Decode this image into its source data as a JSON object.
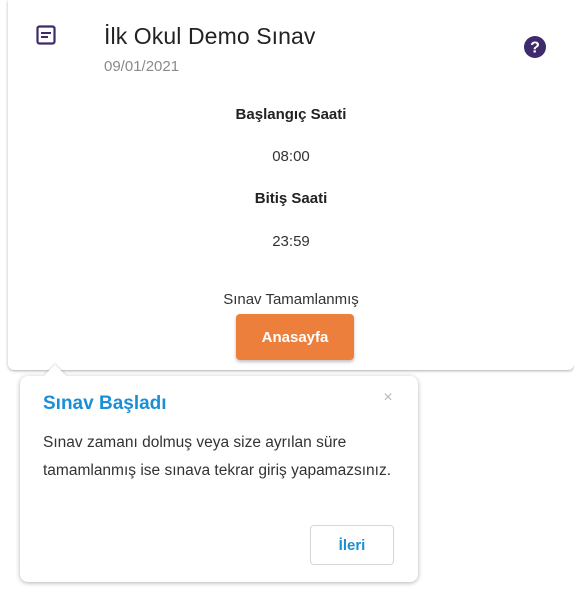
{
  "exam": {
    "title": "İlk Okul Demo Sınav",
    "date": "09/01/2021",
    "start_label": "Başlangıç Saati",
    "start_time": "08:00",
    "end_label": "Bitiş Saati",
    "end_time": "23:59",
    "status": "Sınav Tamamlanmış",
    "home_button": "Anasayfa"
  },
  "tooltip": {
    "title": "Sınav Başladı",
    "close": "×",
    "body": "Sınav zamanı dolmuş veya size ayrılan süre tamamlanmış ise sınava tekrar giriş yapamazsınız.",
    "next_button": "İleri"
  },
  "icons": {
    "exam": "form-document-icon",
    "help": "help-circle-icon",
    "close": "close-icon"
  },
  "colors": {
    "accent_orange": "#ec7f3c",
    "tooltip_blue": "#1b8fd6",
    "icon_purple": "#3f2a6b"
  }
}
